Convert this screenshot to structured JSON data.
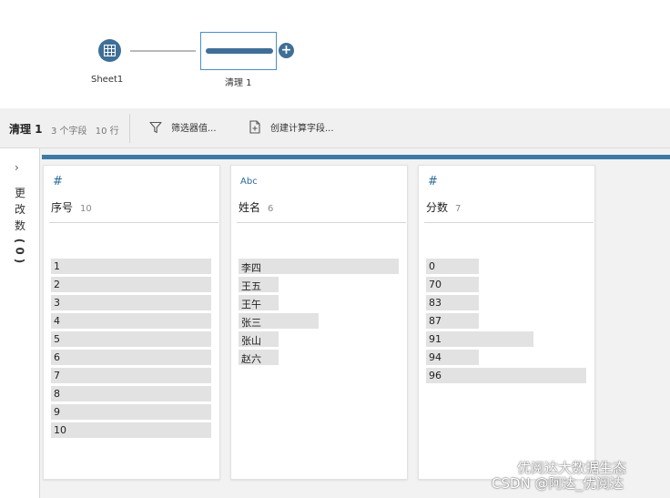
{
  "flow": {
    "sheet_label": "Sheet1",
    "clean_label": "清理 1",
    "add_symbol": "+"
  },
  "toolbar": {
    "title": "清理 1",
    "field_count": "3 个字段",
    "row_count": "10 行",
    "filter_label": "筛选器值...",
    "calc_label": "创建计算字段..."
  },
  "changes": {
    "chevron": "›",
    "label": "更改数",
    "count": "(0)"
  },
  "columns": [
    {
      "type_label": "#",
      "name": "序号",
      "distinct": "10",
      "values": [
        {
          "label": "1",
          "level": 1.0
        },
        {
          "label": "2",
          "level": 1.0
        },
        {
          "label": "3",
          "level": 1.0
        },
        {
          "label": "4",
          "level": 1.0
        },
        {
          "label": "5",
          "level": 1.0
        },
        {
          "label": "6",
          "level": 1.0
        },
        {
          "label": "7",
          "level": 1.0
        },
        {
          "label": "8",
          "level": 1.0
        },
        {
          "label": "9",
          "level": 1.0
        },
        {
          "label": "10",
          "level": 1.0
        }
      ]
    },
    {
      "type_label": "Abc",
      "name": "姓名",
      "distinct": "6",
      "values": [
        {
          "label": "李四",
          "level": 1.0
        },
        {
          "label": "王五",
          "level": 0.25
        },
        {
          "label": "王午",
          "level": 0.25
        },
        {
          "label": "张三",
          "level": 0.5
        },
        {
          "label": "张山",
          "level": 0.25
        },
        {
          "label": "赵六",
          "level": 0.25
        }
      ]
    },
    {
      "type_label": "#",
      "name": "分数",
      "distinct": "7",
      "values": [
        {
          "label": "0",
          "level": 0.33
        },
        {
          "label": "70",
          "level": 0.33
        },
        {
          "label": "83",
          "level": 0.33
        },
        {
          "label": "87",
          "level": 0.33
        },
        {
          "label": "91",
          "level": 0.67
        },
        {
          "label": "94",
          "level": 0.33
        },
        {
          "label": "96",
          "level": 1.0
        }
      ]
    }
  ],
  "watermark": {
    "line1": "优阅达大数据生态",
    "line2": "CSDN @阿达_优阅达"
  },
  "colors": {
    "accent": "#3d7ba6",
    "node": "#3f6f96",
    "bar": "#e2e2e2"
  }
}
